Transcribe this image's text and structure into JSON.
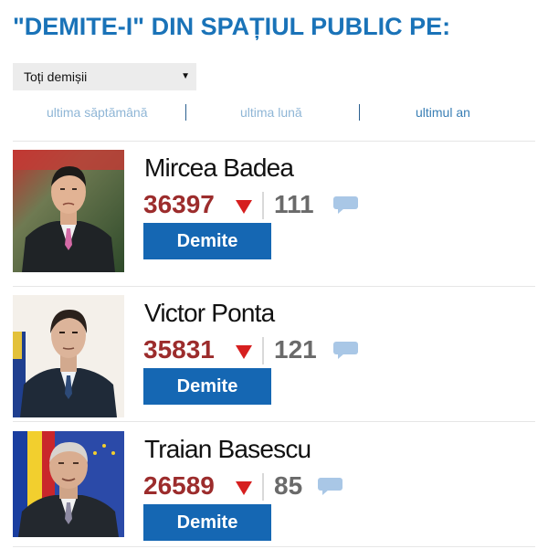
{
  "page": {
    "title": "\"DEMITE-I\" DIN SPAȚIUL PUBLIC PE:"
  },
  "filter_select": {
    "value": "Toți demișii",
    "arrow": "▼"
  },
  "period_filters": [
    {
      "label": "ultima săptămână",
      "active": false
    },
    {
      "label": "ultima lună",
      "active": false
    },
    {
      "label": "ultimul an",
      "active": true
    }
  ],
  "people": [
    {
      "name": "Mircea Badea",
      "score": "36397",
      "trend": "down-arrow-icon",
      "comments": "111",
      "button_label": "Demite"
    },
    {
      "name": "Victor Ponta",
      "score": "35831",
      "trend": "down-arrow-icon",
      "comments": "121",
      "button_label": "Demite"
    },
    {
      "name": "Traian Basescu",
      "score": "26589",
      "trend": "down-arrow-icon",
      "comments": "85",
      "button_label": "Demite"
    }
  ],
  "colors": {
    "title": "#1a73b8",
    "score": "#9c2c2c",
    "trend_arrow": "#d61f1f",
    "button": "#1567b3",
    "comment_bubble": "#a9c7e6"
  }
}
